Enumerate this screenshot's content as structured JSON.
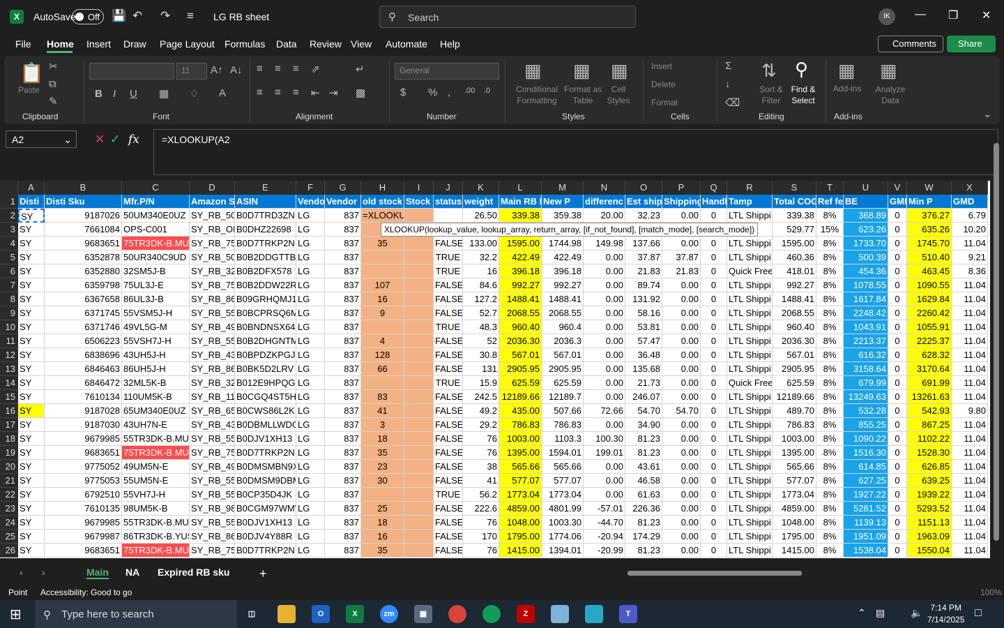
{
  "app": {
    "autosave_label": "AutoSave",
    "autosave_state": "Off",
    "title": "LG RB sheet",
    "search_placeholder": "Search",
    "avatar": "IK"
  },
  "menu": [
    "File",
    "Home",
    "Insert",
    "Draw",
    "Page Layout",
    "Formulas",
    "Data",
    "Review",
    "View",
    "Automate",
    "Help"
  ],
  "buttons": {
    "comments": "Comments",
    "share": "Share"
  },
  "ribbon": {
    "clipboard": "Clipboard",
    "font": "Font",
    "alignment": "Alignment",
    "number": "Number",
    "styles": "Styles",
    "cells": "Cells",
    "editing": "Editing",
    "addins": "Add-ins",
    "paste": "Paste",
    "font_size": "11",
    "number_format": "General",
    "cond_format": "Conditional Formatting",
    "format_table": "Format as Table",
    "cell_styles": "Cell Styles",
    "insert": "Insert",
    "delete": "Delete",
    "format": "Format",
    "sort_filter": "Sort & Filter",
    "find_select": "Find & Select",
    "addins_btn": "Add-ins",
    "analyze": "Analyze Data"
  },
  "formula": {
    "cell_ref": "A2",
    "content": "=XLOOKUP(A2",
    "tooltip": "XLOOKUP(lookup_value, lookup_array, return_array, [if_not_found], [match_mode], [search_mode])"
  },
  "columns": [
    "A",
    "B",
    "C",
    "D",
    "E",
    "F",
    "G",
    "H",
    "I",
    "J",
    "K",
    "L",
    "M",
    "N",
    "O",
    "P",
    "Q",
    "R",
    "S",
    "T",
    "U",
    "V",
    "W",
    "X"
  ],
  "headers": [
    "Disti",
    "Disti Sku",
    "Mfr.P/N",
    "Amazon S",
    "ASIN",
    "Vendo",
    "Vendor",
    "old stock",
    "Stock",
    "status",
    "weight",
    "Main RB I",
    "New P",
    "differenc",
    "Est ship",
    "Shipping",
    "Handl",
    "Tamp",
    "Total COG",
    "Ref fe",
    "BE",
    "GMI",
    "Min P",
    "GMD"
  ],
  "rows": [
    [
      "SY",
      "9187026",
      "50UM340E0UZ",
      "SY_RB_50U",
      "B0D7TRD3ZN",
      "LG",
      "837",
      "=XLOOKUP(A2",
      "",
      "",
      "26.50",
      "339.38",
      "359.38",
      "20.00",
      "32.23",
      "0.00",
      "0",
      "LTL Shippi",
      "339.38",
      "8%",
      "368.89",
      "0",
      "376.27",
      "6.79"
    ],
    [
      "SY",
      "7661084",
      "OPS-C001",
      "SY_RB_OP",
      "B0DHZ22698",
      "LG",
      "837",
      "",
      "",
      "",
      "",
      "",
      "",
      "",
      "",
      "",
      "",
      "",
      "529.77",
      "15%",
      "623.26",
      "0",
      "635.26",
      "10.20"
    ],
    [
      "SY",
      "9683651",
      "75TR3DK-B.MUS",
      "SY_RB_75T",
      "B0D7TRKP2N",
      "LG",
      "837",
      "35",
      "",
      "FALSE",
      "133.00",
      "1595.00",
      "1744.98",
      "149.98",
      "137.66",
      "0.00",
      "0",
      "LTL Shippi",
      "1595.00",
      "8%",
      "1733.70",
      "0",
      "1745.70",
      "11.04"
    ],
    [
      "SY",
      "6352878",
      "50UR340C9UD",
      "SY_RB_50U",
      "B0B2DDGTTB",
      "LG",
      "837",
      "",
      "",
      "TRUE",
      "32.2",
      "422.49",
      "422.49",
      "0.00",
      "37.87",
      "37.87",
      "0",
      "LTL Shippi",
      "460.36",
      "8%",
      "500.39",
      "0",
      "510.40",
      "9.21"
    ],
    [
      "SY",
      "6352880",
      "32SM5J-B",
      "SY_RB_32S",
      "B0B2DFX578",
      "LG",
      "837",
      "",
      "",
      "TRUE",
      "16",
      "396.18",
      "396.18",
      "0.00",
      "21.83",
      "21.83",
      "0",
      "Quick Free",
      "418.01",
      "8%",
      "454.36",
      "0",
      "463.45",
      "8.36"
    ],
    [
      "SY",
      "6359798",
      "75UL3J-E",
      "SY_RB_75U",
      "B0B2DDW22R",
      "LG",
      "837",
      "107",
      "",
      "FALSE",
      "84.6",
      "992.27",
      "992.27",
      "0.00",
      "89.74",
      "0.00",
      "0",
      "LTL Shippi",
      "992.27",
      "8%",
      "1078.55",
      "0",
      "1090.55",
      "11.04"
    ],
    [
      "SY",
      "6367658",
      "86UL3J-B",
      "SY_RB_86U",
      "B09GRHQMJ1",
      "LG",
      "837",
      "16",
      "",
      "FALSE",
      "127.2",
      "1488.41",
      "1488.41",
      "0.00",
      "131.92",
      "0.00",
      "0",
      "LTL Shippi",
      "1488.41",
      "8%",
      "1617.84",
      "0",
      "1629.84",
      "11.04"
    ],
    [
      "SY",
      "6371745",
      "55VSM5J-H",
      "SY_RB_55V",
      "B0BCPRSQ6M",
      "LG",
      "837",
      "9",
      "",
      "FALSE",
      "52.7",
      "2068.55",
      "2068.55",
      "0.00",
      "58.16",
      "0.00",
      "0",
      "LTL Shippi",
      "2068.55",
      "8%",
      "2248.42",
      "0",
      "2260.42",
      "11.04"
    ],
    [
      "SY",
      "6371746",
      "49VL5G-M",
      "SY_RB_49V",
      "B0BNDNSX64",
      "LG",
      "837",
      "",
      "",
      "TRUE",
      "48.3",
      "960.40",
      "960.4",
      "0.00",
      "53.81",
      "0.00",
      "0",
      "LTL Shippi",
      "960.40",
      "8%",
      "1043.91",
      "0",
      "1055.91",
      "11.04"
    ],
    [
      "SY",
      "6506223",
      "55VSH7J-H",
      "SY_RB_55V",
      "B0B2DHGNTM",
      "LG",
      "837",
      "4",
      "",
      "FALSE",
      "52",
      "2036.30",
      "2036.3",
      "0.00",
      "57.47",
      "0.00",
      "0",
      "LTL Shippi",
      "2036.30",
      "8%",
      "2213.37",
      "0",
      "2225.37",
      "11.04"
    ],
    [
      "SY",
      "6838696",
      "43UH5J-H",
      "SY_RB_43U",
      "B0BPDZKPGJ",
      "LG",
      "837",
      "128",
      "",
      "FALSE",
      "30.8",
      "567.01",
      "567.01",
      "0.00",
      "36.48",
      "0.00",
      "0",
      "LTL Shippi",
      "567.01",
      "8%",
      "616.32",
      "0",
      "628.32",
      "11.04"
    ],
    [
      "SY",
      "6846463",
      "86UH5J-H",
      "SY_RB_86U",
      "B0BK5D2LRV",
      "LG",
      "837",
      "66",
      "",
      "FALSE",
      "131",
      "2905.95",
      "2905.95",
      "0.00",
      "135.68",
      "0.00",
      "0",
      "LTL Shippi",
      "2905.95",
      "8%",
      "3158.64",
      "0",
      "3170.64",
      "11.04"
    ],
    [
      "SY",
      "6846472",
      "32ML5K-B",
      "SY_RB_32M",
      "B012E9HPQG",
      "LG",
      "837",
      "",
      "",
      "TRUE",
      "15.9",
      "625.59",
      "625.59",
      "0.00",
      "21.73",
      "0.00",
      "0",
      "Quick Free",
      "625.59",
      "8%",
      "679.99",
      "0",
      "691.99",
      "11.04"
    ],
    [
      "SY",
      "7610134",
      "110UM5K-B",
      "SY_RB_110",
      "B0CGQ4ST5H",
      "LG",
      "837",
      "83",
      "",
      "FALSE",
      "242.5",
      "12189.66",
      "12189.7",
      "0.00",
      "246.07",
      "0.00",
      "0",
      "LTL Shippi",
      "12189.66",
      "8%",
      "13249.63",
      "0",
      "13261.63",
      "11.04"
    ],
    [
      "SY",
      "9187028",
      "65UM340E0UZ",
      "SY_RB_65U",
      "B0CWS86L2K",
      "LG",
      "837",
      "41",
      "",
      "FALSE",
      "49.2",
      "435.00",
      "507.66",
      "72.66",
      "54.70",
      "54.70",
      "0",
      "LTL Shippi",
      "489.70",
      "8%",
      "532.28",
      "0",
      "542.93",
      "9.80"
    ],
    [
      "SY",
      "9187030",
      "43UH7N-E",
      "SY_RB_43U",
      "B0DBMLLWDG",
      "LG",
      "837",
      "3",
      "",
      "FALSE",
      "29.2",
      "786.83",
      "786.83",
      "0.00",
      "34.90",
      "0.00",
      "0",
      "LTL Shippi",
      "786.83",
      "8%",
      "855.25",
      "0",
      "867.25",
      "11.04"
    ],
    [
      "SY",
      "9679985",
      "55TR3DK-B.MUS",
      "SY_RB_55T",
      "B0DJV1XH13",
      "LG",
      "837",
      "18",
      "",
      "FALSE",
      "76",
      "1003.00",
      "1103.3",
      "100.30",
      "81.23",
      "0.00",
      "0",
      "LTL Shippi",
      "1003.00",
      "8%",
      "1090.22",
      "0",
      "1102.22",
      "11.04"
    ],
    [
      "SY",
      "9683651",
      "75TR3DK-B.MUS",
      "SY_RB_75T",
      "B0D7TRKP2N",
      "LG",
      "837",
      "35",
      "",
      "FALSE",
      "76",
      "1395.00",
      "1594.01",
      "199.01",
      "81.23",
      "0.00",
      "0",
      "LTL Shippi",
      "1395.00",
      "8%",
      "1516.30",
      "0",
      "1528.30",
      "11.04"
    ],
    [
      "SY",
      "9775052",
      "49UM5N-E",
      "SY_RB_49U",
      "B0DMSMBN9X",
      "LG",
      "837",
      "23",
      "",
      "FALSE",
      "38",
      "565.66",
      "565.66",
      "0.00",
      "43.61",
      "0.00",
      "0",
      "LTL Shippi",
      "565.66",
      "8%",
      "614.85",
      "0",
      "626.85",
      "11.04"
    ],
    [
      "SY",
      "9775053",
      "55UM5N-E",
      "SY_RB_55U",
      "B0DMSM9DBM",
      "LG",
      "837",
      "30",
      "",
      "FALSE",
      "41",
      "577.07",
      "577.07",
      "0.00",
      "46.58",
      "0.00",
      "0",
      "LTL Shippi",
      "577.07",
      "8%",
      "627.25",
      "0",
      "639.25",
      "11.04"
    ],
    [
      "SY",
      "6792510",
      "55VH7J-H",
      "SY_RB_55V",
      "B0CP35D4JK",
      "LG",
      "837",
      "",
      "",
      "TRUE",
      "56.2",
      "1773.04",
      "1773.04",
      "0.00",
      "61.63",
      "0.00",
      "0",
      "LTL Shippi",
      "1773.04",
      "8%",
      "1927.22",
      "0",
      "1939.22",
      "11.04"
    ],
    [
      "SY",
      "7610135",
      "98UM5K-B",
      "SY_RB_98U",
      "B0CGM97WMV",
      "LG",
      "837",
      "25",
      "",
      "FALSE",
      "222.6",
      "4859.00",
      "4801.99",
      "-57.01",
      "226.36",
      "0.00",
      "0",
      "LTL Shippi",
      "4859.00",
      "8%",
      "5281.52",
      "0",
      "5293.52",
      "11.04"
    ],
    [
      "SY",
      "9679985",
      "55TR3DK-B.MUS",
      "SY_RB_55T",
      "B0DJV1XH13",
      "LG",
      "837",
      "18",
      "",
      "FALSE",
      "76",
      "1048.00",
      "1003.30",
      "-44.70",
      "81.23",
      "0.00",
      "0",
      "LTL Shippi",
      "1048.00",
      "8%",
      "1139.13",
      "0",
      "1151.13",
      "11.04"
    ],
    [
      "SY",
      "9679987",
      "86TR3DK-B.YUS",
      "SY_RB_86T",
      "B0DJV4Y88R",
      "LG",
      "837",
      "16",
      "",
      "FALSE",
      "170",
      "1795.00",
      "1774.06",
      "-20.94",
      "174.29",
      "0.00",
      "0",
      "LTL Shippi",
      "1795.00",
      "8%",
      "1951.09",
      "0",
      "1963.09",
      "11.04"
    ],
    [
      "SY",
      "9683651",
      "75TR3DK-B.MUS",
      "SY_RB_75T",
      "B0D7TRKP2N",
      "LG",
      "837",
      "35",
      "",
      "FALSE",
      "76",
      "1415.00",
      "1394.01",
      "-20.99",
      "81.23",
      "0.00",
      "0",
      "LTL Shippi",
      "1415.00",
      "8%",
      "1538.04",
      "0",
      "1550.04",
      "11.04"
    ]
  ],
  "sheets": [
    "Main",
    "NA",
    "Expired RB sku"
  ],
  "status": {
    "mode": "Point",
    "accessibility": "Accessibility: Good to go",
    "zoom": "100%"
  },
  "taskbar": {
    "search": "Type here to search",
    "time": "7:14 PM",
    "date": "7/14/2025"
  },
  "colors": {
    "yellow": "#ffff00",
    "blue": "#1aa3e8",
    "salmon": "#f4b183",
    "red": "#ff4d4d",
    "header": "#0078d4"
  }
}
